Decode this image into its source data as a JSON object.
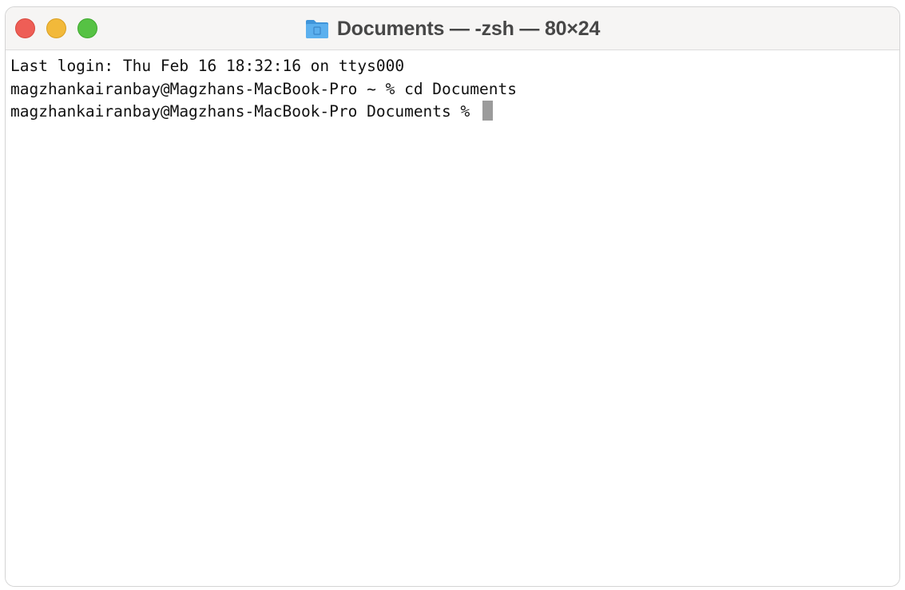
{
  "window": {
    "title": "Documents — -zsh — 80×24",
    "title_icon": "folder-icon",
    "controls": [
      "close",
      "minimize",
      "zoom"
    ],
    "colors": {
      "close": "#ee5e56",
      "minimize": "#f2b93a",
      "zoom": "#56c244",
      "folder": "#4ea3e6"
    }
  },
  "terminal": {
    "lines": [
      "Last login: Thu Feb 16 18:32:16 on ttys000",
      "magzhankairanbay@Magzhans-MacBook-Pro ~ % cd Documents",
      "magzhankairanbay@Magzhans-MacBook-Pro Documents % "
    ],
    "cursor": "block"
  }
}
